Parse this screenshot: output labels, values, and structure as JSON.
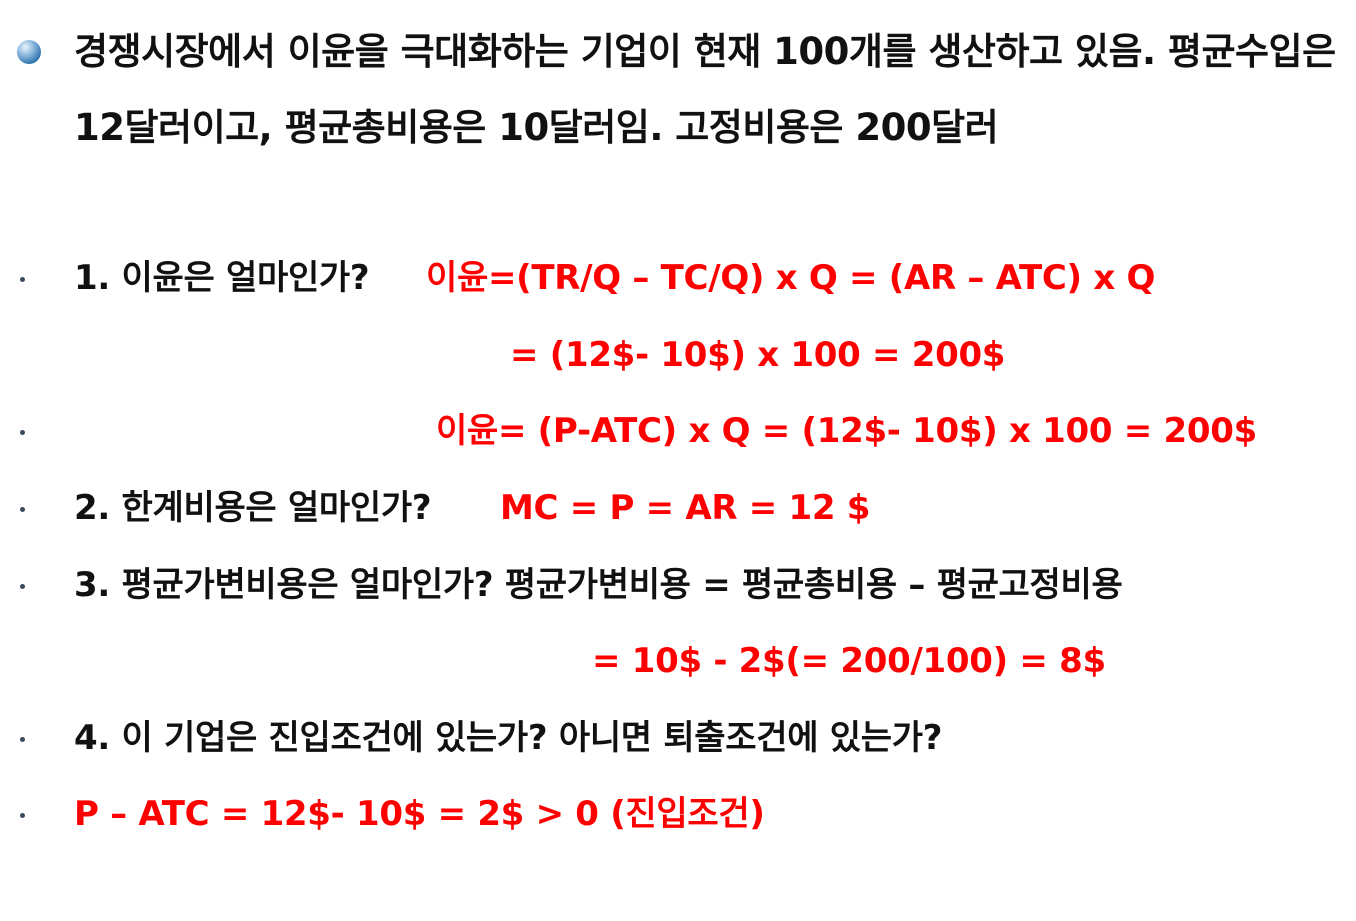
{
  "main": {
    "text": "경쟁시장에서 이윤을 극대화하는 기업이 현재 100개를 생산하고 있음. 평균수입은 12달러이고, 평균총비용은 10달러임. 고정비용은 200달러"
  },
  "q1": {
    "question": "1. 이윤은 얼마인가?",
    "formula": "이윤=(TR/Q – TC/Q) x Q = (AR – ATC) x Q",
    "calc": "= (12$- 10$) x 100 = 200$",
    "alt": "이윤= (P-ATC) x Q = (12$- 10$) x 100 = 200$"
  },
  "q2": {
    "question": "2. 한계비용은 얼마인가?",
    "answer": "MC = P = AR = 12 $"
  },
  "q3": {
    "question": "3. 평균가변비용은 얼마인가? 평균가변비용 = 평균총비용 – 평균고정비용",
    "calc": "= 10$ - 2$(= 200/100) = 8$"
  },
  "q4": {
    "question": "4. 이 기업은 진입조건에 있는가? 아니면 퇴출조건에 있는가?",
    "answer": "P – ATC = 12$- 10$ = 2$ > 0 (진입조건)"
  }
}
